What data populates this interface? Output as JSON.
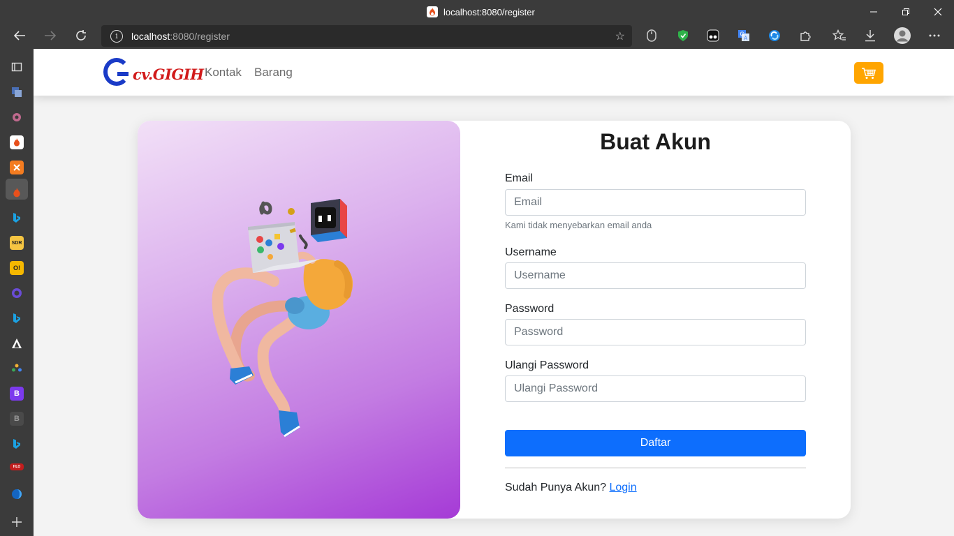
{
  "browser": {
    "tab_title": "localhost:8080/register",
    "url_host": "localhost",
    "url_rest": ":8080/register",
    "info_icon": "i"
  },
  "navbar": {
    "logo_text": "cv.GIGIH",
    "links": [
      "Kontak",
      "Barang"
    ]
  },
  "form": {
    "title": "Buat Akun",
    "email_label": "Email",
    "email_placeholder": "Email",
    "email_help": "Kami tidak menyebarkan email anda",
    "username_label": "Username",
    "username_placeholder": "Username",
    "password_label": "Password",
    "password_placeholder": "Password",
    "repeat_label": "Ulangi Password",
    "repeat_placeholder": "Ulangi Password",
    "submit_label": "Daftar",
    "login_prompt": "Sudah Punya Akun?",
    "login_link": "Login"
  },
  "sidebar": {
    "badges": [
      "SDR",
      "O!",
      "B",
      "B",
      "HLO"
    ]
  },
  "colors": {
    "accent": "#0d6efd",
    "cart": "#ffa500",
    "logo_red": "#d11a1a",
    "logo_blue": "#1a3bc7"
  }
}
